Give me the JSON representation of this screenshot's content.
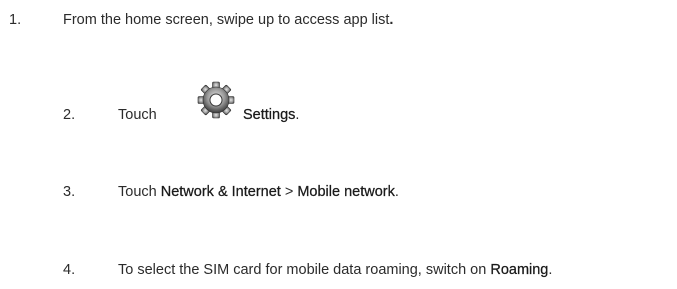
{
  "steps": [
    {
      "number": "1.",
      "text": "From the home screen, swipe up to access app list",
      "trailing": "."
    },
    {
      "number": "2.",
      "before": "Touch",
      "icon": "settings-gear-icon",
      "target": "Settings",
      "after": "."
    },
    {
      "number": "3.",
      "before": "Touch ",
      "target1": "Network & Internet",
      "separator": " > ",
      "target2": "Mobile network",
      "after": "."
    },
    {
      "number": "4.",
      "before": "To select the SIM card for mobile data roaming, switch on ",
      "target": "Roaming",
      "after": "."
    }
  ],
  "colors": {
    "text": "#2b2b2b",
    "icon_dark": "#3a3a3a",
    "icon_light": "#d9d9d9"
  }
}
